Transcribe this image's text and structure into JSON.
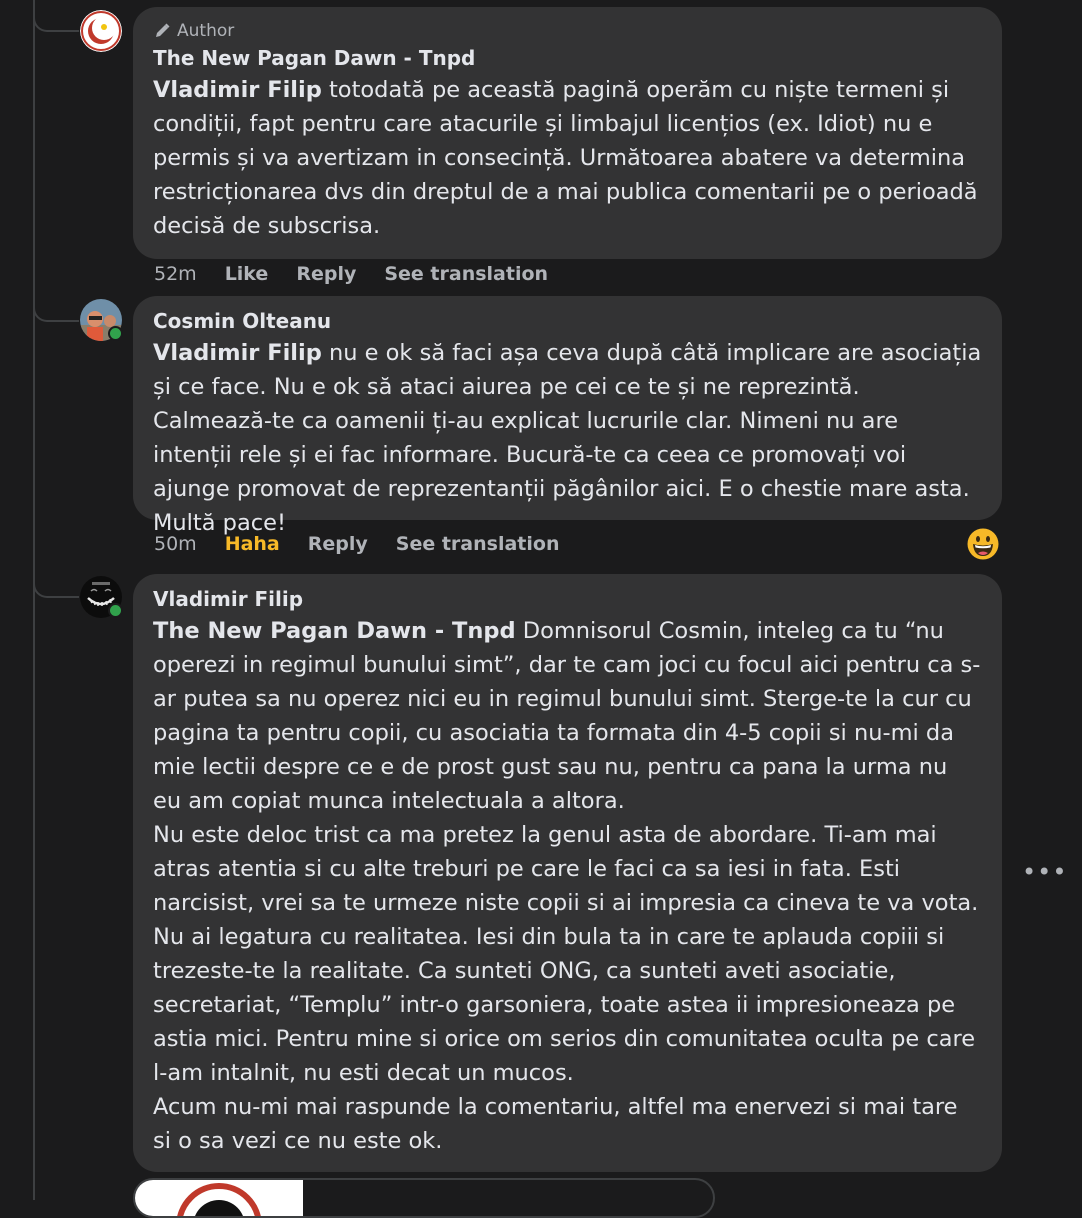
{
  "comments": [
    {
      "badge": "Author",
      "name": "The New Pagan Dawn - Tnpd",
      "mention": "Vladimir Filip",
      "text": " totodată pe această pagină operăm cu niște termeni și condiții, fapt pentru care atacurile și limbajul licențios (ex. Idiot) nu e permis și va avertizam in consecință. Următoarea abatere va determina restricționarea dvs din dreptul de a mai publica comentarii pe o perioadă decisă de subscrisa.",
      "time": "52m",
      "like": "Like",
      "reply": "Reply",
      "translate": "See translation"
    },
    {
      "name": "Cosmin Olteanu",
      "mention": "Vladimir Filip",
      "text": " nu e ok să faci așa ceva după câtă implicare are asociația și ce face. Nu e ok să ataci aiurea pe cei ce te și ne reprezintă. Calmează-te ca oamenii ți-au explicat lucrurile clar. Nimeni nu are intenții rele și ei fac informare. Bucură-te ca ceea ce promovați voi ajunge promovat de reprezentanții păgânilor aici. E o chestie mare asta. Multă pace!",
      "time": "50m",
      "reaction": "Haha",
      "reply": "Reply",
      "translate": "See translation"
    },
    {
      "name": "Vladimir Filip",
      "mention": "The New Pagan Dawn - Tnpd",
      "text": " Domnisorul Cosmin, inteleg ca tu “nu operezi in regimul bunului simt”, dar te cam joci cu focul aici pentru ca s-ar putea sa nu operez nici eu in regimul bunului simt. Sterge-te la cur cu pagina ta pentru copii, cu asociatia ta formata din 4-5 copii si nu-mi da mie lectii despre ce e de prost gust sau nu, pentru ca pana la urma nu eu am copiat munca intelectuala a altora.\nNu este deloc trist ca ma pretez la genul asta de abordare. Ti-am mai atras atentia si cu alte treburi pe care le faci ca sa iesi in fata. Esti narcisist, vrei sa te urmeze niste copii si ai impresia ca cineva te va vota. Nu ai legatura cu realitatea. Iesi din bula ta in care te aplauda copiii si trezeste-te la realitate. Ca sunteti ONG, ca sunteti aveti asociatie, secretariat, “Templu” intr-o garsoniera, toate astea ii impresioneaza pe astia mici. Pentru mine si orice om serios din comunitatea oculta pe care l-am intalnit, nu esti decat un mucos.\nAcum nu-mi mai raspunde la comentariu, altfel ma enervezi si mai tare si o sa vezi ce nu este ok."
    }
  ],
  "icons": {
    "author_badge": "pencil-icon",
    "reaction_emoji": "grinning-face-icon",
    "more": "more-options-icon"
  },
  "colors": {
    "background": "#1b1b1c",
    "bubble": "#333334",
    "haha": "#f7b928",
    "online": "#31a24c"
  }
}
